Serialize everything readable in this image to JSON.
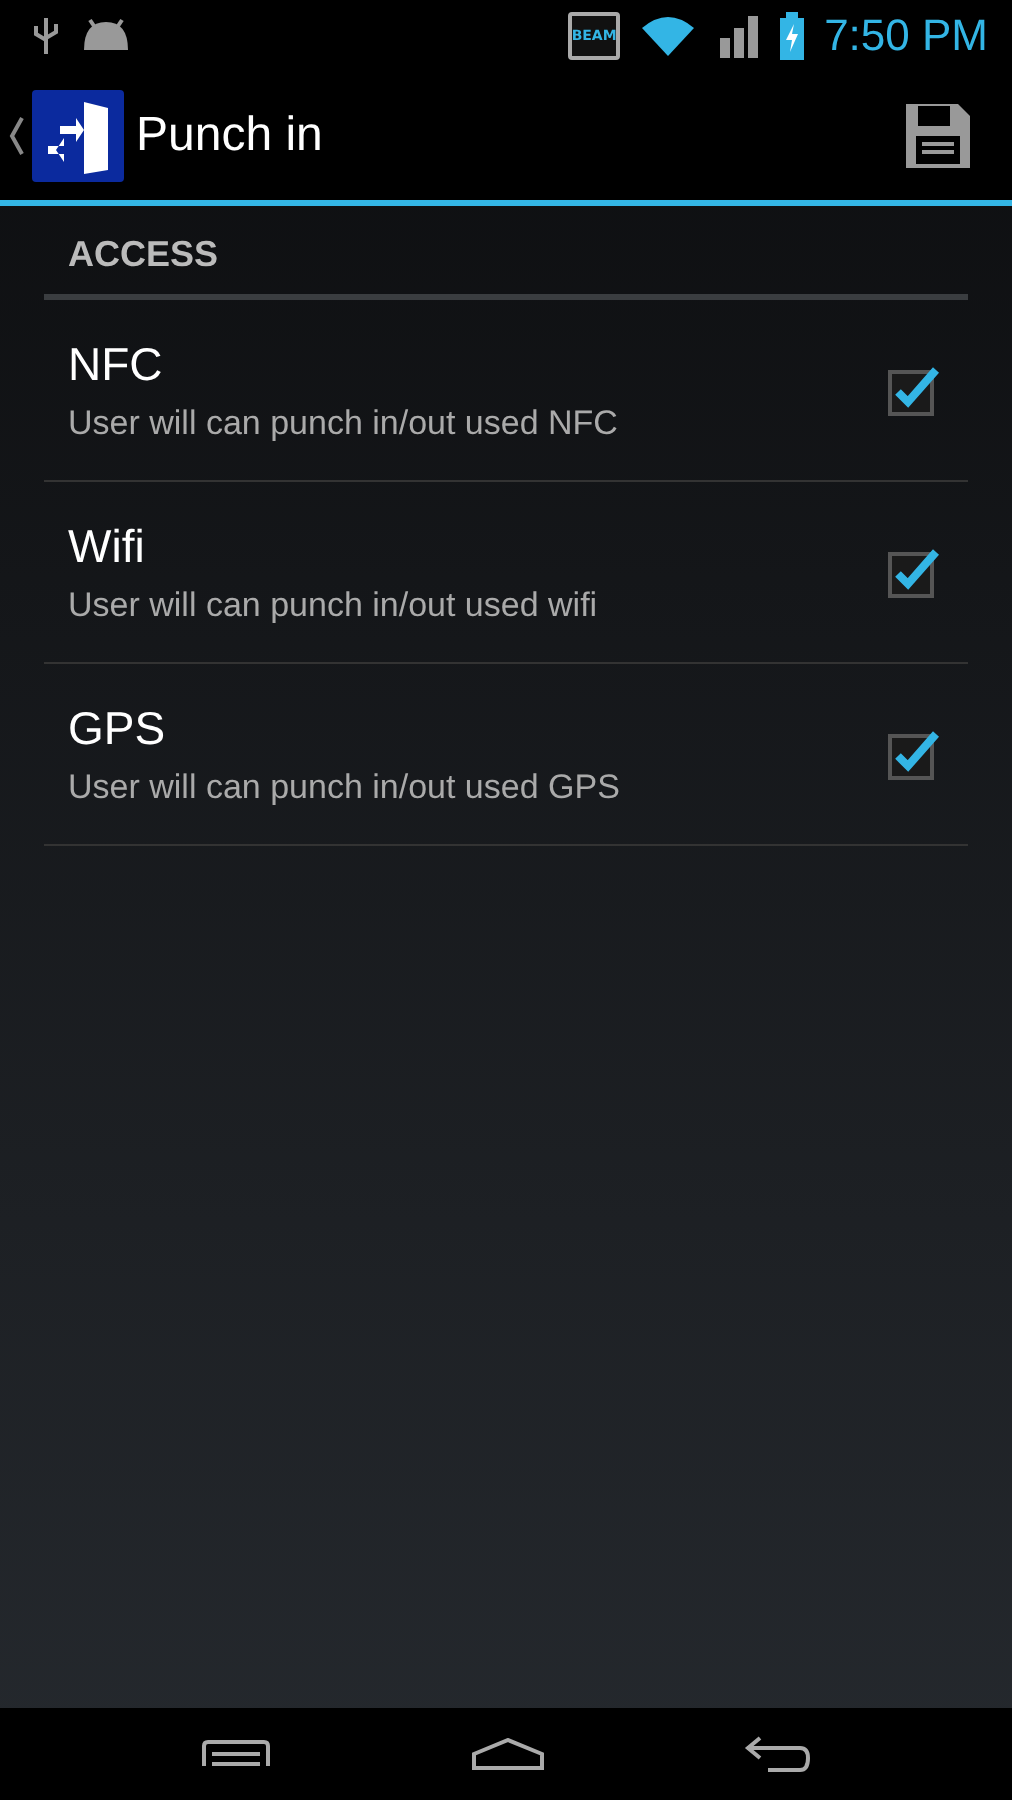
{
  "status_bar": {
    "beam_label": "BEAM",
    "time": "7:50 PM"
  },
  "action_bar": {
    "title": "Punch in"
  },
  "section": {
    "title": "ACCESS"
  },
  "settings": [
    {
      "title": "NFC",
      "summary": "User will can punch in/out used NFC",
      "checked": true
    },
    {
      "title": "Wifi",
      "summary": "User will can punch in/out used wifi",
      "checked": true
    },
    {
      "title": "GPS",
      "summary": "User will can punch in/out used GPS",
      "checked": true
    }
  ]
}
